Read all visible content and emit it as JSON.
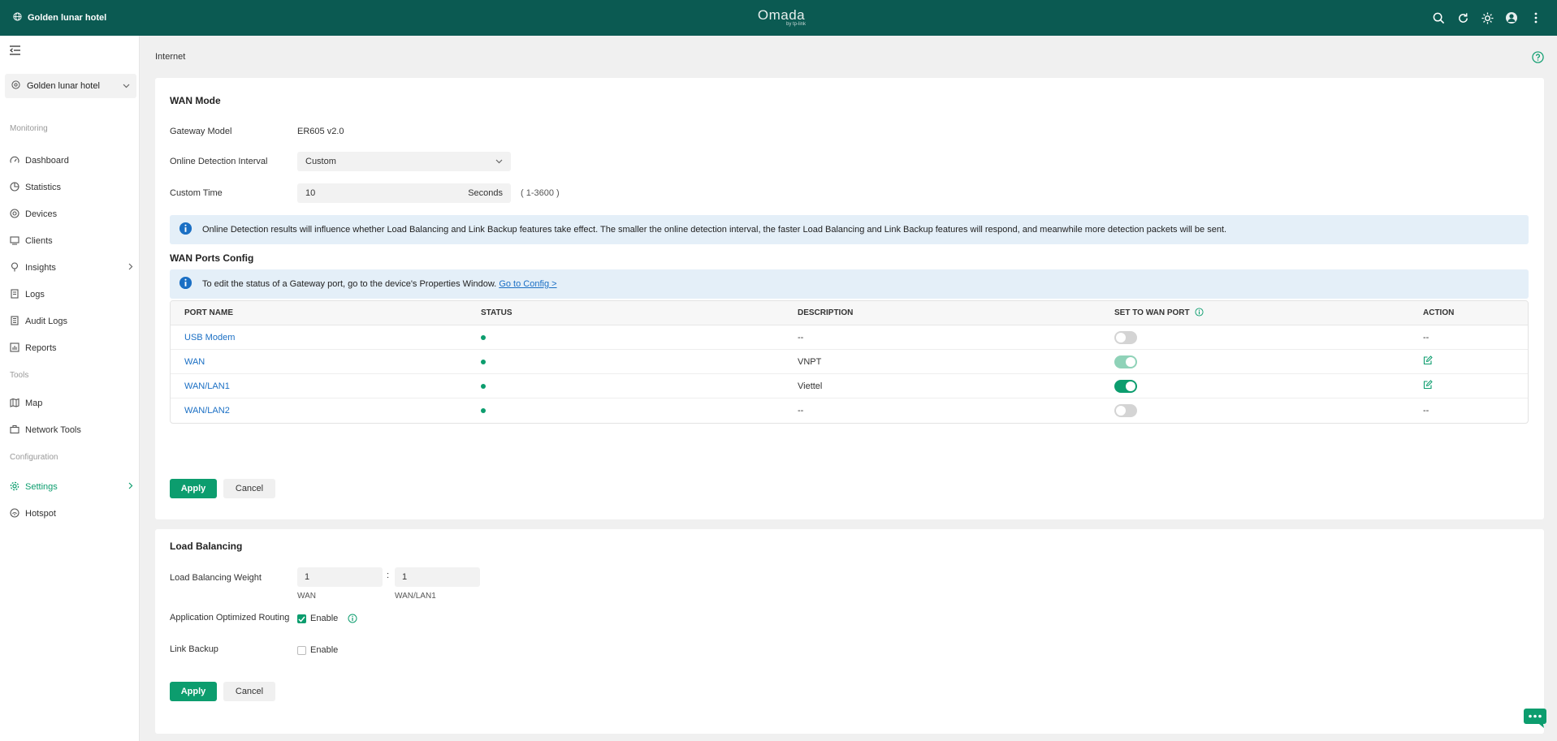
{
  "topbar": {
    "site_name": "Golden lunar hotel",
    "logo": "Omada",
    "logo_sub": "by tp-link"
  },
  "sidebar": {
    "site_select": "Golden lunar hotel",
    "sections": {
      "monitoring": "Monitoring",
      "tools": "Tools",
      "configuration": "Configuration"
    },
    "items": [
      {
        "label": "Dashboard"
      },
      {
        "label": "Statistics"
      },
      {
        "label": "Devices"
      },
      {
        "label": "Clients"
      },
      {
        "label": "Insights"
      },
      {
        "label": "Logs"
      },
      {
        "label": "Audit Logs"
      },
      {
        "label": "Reports"
      },
      {
        "label": "Map"
      },
      {
        "label": "Network Tools"
      },
      {
        "label": "Settings"
      },
      {
        "label": "Hotspot"
      }
    ]
  },
  "page": {
    "title": "Internet"
  },
  "wan_mode": {
    "title": "WAN Mode",
    "gateway_model_label": "Gateway Model",
    "gateway_model_value": "ER605 v2.0",
    "detection_label": "Online Detection Interval",
    "detection_value": "Custom",
    "custom_time_label": "Custom Time",
    "custom_time_value": "10",
    "custom_time_unit": "Seconds",
    "custom_time_range": "( 1-3600 )",
    "notice": "Online Detection results will influence whether Load Balancing and Link Backup features take effect. The smaller the online detection interval, the faster Load Balancing and Link Backup features will respond, and meanwhile more detection packets will be sent."
  },
  "wan_ports": {
    "title": "WAN Ports Config",
    "notice": "To edit the status of a Gateway port, go to the device's Properties Window.",
    "notice_link": "Go to Config >",
    "columns": [
      "PORT NAME",
      "STATUS",
      "DESCRIPTION",
      "SET TO WAN PORT",
      "ACTION"
    ],
    "rows": [
      {
        "name": "USB Modem",
        "description": "--",
        "wan": "off",
        "action": "--"
      },
      {
        "name": "WAN",
        "description": "VNPT",
        "wan": "on-disabled",
        "action": "edit"
      },
      {
        "name": "WAN/LAN1",
        "description": "Viettel",
        "wan": "on",
        "action": "edit"
      },
      {
        "name": "WAN/LAN2",
        "description": "--",
        "wan": "off",
        "action": "--"
      }
    ],
    "apply": "Apply",
    "cancel": "Cancel"
  },
  "load_balancing": {
    "title": "Load Balancing",
    "weight_label": "Load Balancing Weight",
    "weight_1": "1",
    "weight_2": "1",
    "separator": ":",
    "weight_1_name": "WAN",
    "weight_2_name": "WAN/LAN1",
    "aor_label": "Application Optimized Routing",
    "aor_checked": true,
    "enable_label": "Enable",
    "link_backup_label": "Link Backup",
    "link_backup_checked": false,
    "apply": "Apply",
    "cancel": "Cancel"
  },
  "colors": {
    "header": "#0b5a52",
    "accent": "#0c9d6e",
    "link": "#1a6fc4",
    "notice_bg": "#e4eff8"
  }
}
